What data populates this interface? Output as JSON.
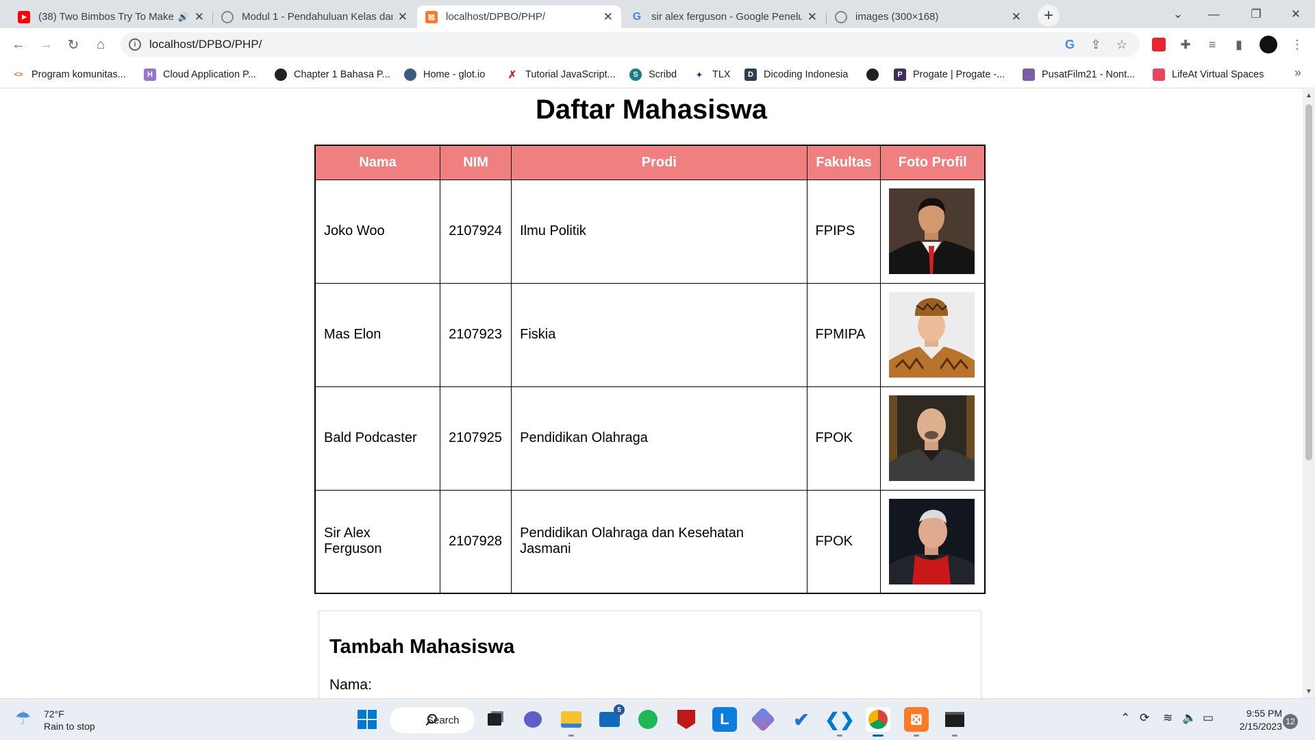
{
  "browser": {
    "tabs": [
      {
        "title": "(38) Two Bimbos Try To Make",
        "favicon": "youtube-icon",
        "audio": true,
        "active": false
      },
      {
        "title": "Modul 1 - Pendahuluan Kelas dar",
        "favicon": "globe-icon",
        "audio": false,
        "active": false
      },
      {
        "title": "localhost/DPBO/PHP/",
        "favicon": "xampp-icon",
        "audio": false,
        "active": true
      },
      {
        "title": "sir alex ferguson - Google Penelu",
        "favicon": "google-icon",
        "audio": false,
        "active": false
      },
      {
        "title": "images (300×168)",
        "favicon": "globe-icon",
        "audio": false,
        "active": false
      }
    ],
    "new_tab": "+",
    "url": "localhost/DPBO/PHP/",
    "bookmarks": [
      {
        "label": "Program komunitas..."
      },
      {
        "label": "Cloud Application P..."
      },
      {
        "label": "Chapter 1 Bahasa P..."
      },
      {
        "label": "Home - glot.io"
      },
      {
        "label": "Tutorial JavaScript..."
      },
      {
        "label": "Scribd"
      },
      {
        "label": "TLX"
      },
      {
        "label": "Dicoding Indonesia"
      },
      {
        "label": ""
      },
      {
        "label": "Progate | Progate -..."
      },
      {
        "label": "PusatFilm21 - Nont..."
      },
      {
        "label": "LifeAt Virtual Spaces"
      }
    ],
    "bookmarks_more": "»"
  },
  "page": {
    "title": "Daftar Mahasiswa",
    "table": {
      "headers": [
        "Nama",
        "NIM",
        "Prodi",
        "Fakultas",
        "Foto Profil"
      ],
      "rows": [
        {
          "nama": "Joko Woo",
          "nim": "2107924",
          "prodi": "Ilmu Politik",
          "fakultas": "FPIPS",
          "foto": "portrait-suit-red-tie"
        },
        {
          "nama": "Mas Elon",
          "nim": "2107923",
          "prodi": "Fiskia",
          "fakultas": "FPMIPA",
          "foto": "portrait-batik"
        },
        {
          "nama": "Bald Podcaster",
          "nim": "2107925",
          "prodi": "Pendidikan Olahraga",
          "fakultas": "FPOK",
          "foto": "portrait-bald-man"
        },
        {
          "nama": "Sir Alex Ferguson",
          "nim": "2107928",
          "prodi": "Pendidikan Olahraga dan Kesehatan Jasmani",
          "fakultas": "FPOK",
          "foto": "portrait-red-scarf"
        }
      ]
    },
    "form": {
      "title": "Tambah Mahasiswa",
      "nama_label": "Nama:"
    }
  },
  "taskbar": {
    "weather_temp": "72°F",
    "weather_desc": "Rain to stop",
    "search_label": "Search",
    "mail_badge": "5",
    "time": "9:55 PM",
    "date": "2/15/2023",
    "notifications": "12"
  },
  "colors": {
    "table_header_bg": "#f08080",
    "tab_strip": "#dee1e6",
    "taskbar": "#e9eef5"
  }
}
